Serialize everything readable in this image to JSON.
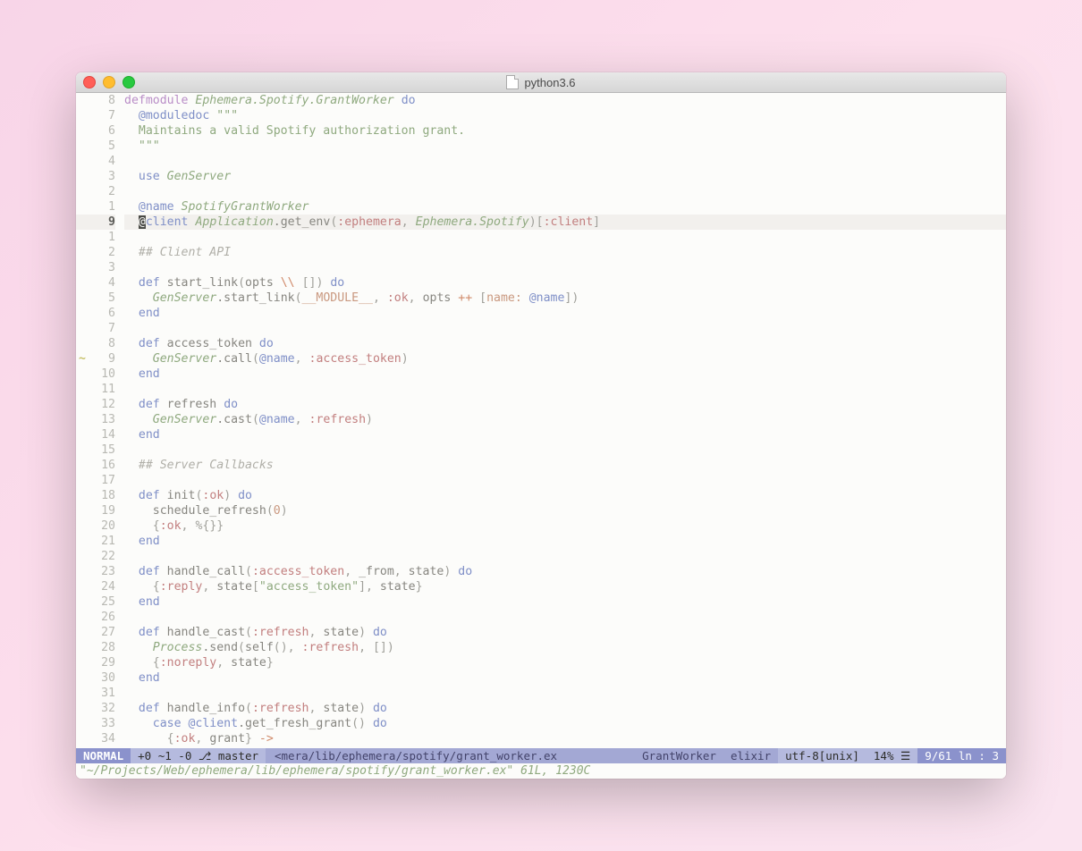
{
  "window": {
    "title": "python3.6"
  },
  "status": {
    "mode": "NORMAL",
    "git_stats": "+0 ~1 -0",
    "git_branch": "master",
    "filepath": "<mera/lib/ephemera/spotify/grant_worker.ex",
    "tag": "GrantWorker",
    "filetype": "elixir",
    "encoding": "utf-8[unix]",
    "percent": "14% ☰",
    "position": "9/61 ln : 3"
  },
  "cmdline": "\"~/Projects/Web/ephemera/lib/ephemera/spotify/grant_worker.ex\" 61L, 1230C",
  "cursor_line_index": 8,
  "lines": [
    {
      "rel": "8",
      "sign": "",
      "tokens": [
        [
          "decl",
          "defmodule"
        ],
        [
          "",
          " "
        ],
        [
          "mod",
          "Ephemera.Spotify.GrantWorker"
        ],
        [
          "",
          " "
        ],
        [
          "kw",
          "do"
        ]
      ]
    },
    {
      "rel": "7",
      "sign": "",
      "tokens": [
        [
          "",
          "  "
        ],
        [
          "attr",
          "@moduledoc"
        ],
        [
          "",
          " "
        ],
        [
          "str",
          "\"\"\""
        ]
      ]
    },
    {
      "rel": "6",
      "sign": "",
      "tokens": [
        [
          "str",
          "  Maintains a valid Spotify authorization grant."
        ]
      ]
    },
    {
      "rel": "5",
      "sign": "",
      "tokens": [
        [
          "str",
          "  \"\"\""
        ]
      ]
    },
    {
      "rel": "4",
      "sign": "",
      "tokens": [
        [
          "",
          ""
        ]
      ]
    },
    {
      "rel": "3",
      "sign": "",
      "tokens": [
        [
          "",
          "  "
        ],
        [
          "kw",
          "use"
        ],
        [
          "",
          " "
        ],
        [
          "mod",
          "GenServer"
        ]
      ]
    },
    {
      "rel": "2",
      "sign": "",
      "tokens": [
        [
          "",
          ""
        ]
      ]
    },
    {
      "rel": "1",
      "sign": "",
      "tokens": [
        [
          "",
          "  "
        ],
        [
          "attr",
          "@name"
        ],
        [
          "",
          " "
        ],
        [
          "mod",
          "SpotifyGrantWorker"
        ]
      ]
    },
    {
      "rel": "9",
      "sign": "",
      "cursor": true,
      "tokens": [
        [
          "",
          "  "
        ],
        [
          "cursor",
          "@"
        ],
        [
          "attr",
          "client"
        ],
        [
          "",
          " "
        ],
        [
          "mod",
          "Application"
        ],
        [
          "fn",
          ".get_env"
        ],
        [
          "paren",
          "("
        ],
        [
          "atom",
          ":ephemera"
        ],
        [
          "paren",
          ","
        ],
        [
          "",
          " "
        ],
        [
          "mod",
          "Ephemera.Spotify"
        ],
        [
          "paren",
          ")["
        ],
        [
          "atom",
          ":client"
        ],
        [
          "paren",
          "]"
        ]
      ]
    },
    {
      "rel": "1",
      "sign": "",
      "tokens": [
        [
          "",
          ""
        ]
      ]
    },
    {
      "rel": "2",
      "sign": "",
      "tokens": [
        [
          "",
          "  "
        ],
        [
          "comm",
          "## Client API"
        ]
      ]
    },
    {
      "rel": "3",
      "sign": "",
      "tokens": [
        [
          "",
          ""
        ]
      ]
    },
    {
      "rel": "4",
      "sign": "",
      "tokens": [
        [
          "",
          "  "
        ],
        [
          "kw",
          "def"
        ],
        [
          "",
          " "
        ],
        [
          "fn",
          "start_link"
        ],
        [
          "paren",
          "("
        ],
        [
          "var",
          "opts "
        ],
        [
          "op",
          "\\\\"
        ],
        [
          "",
          " "
        ],
        [
          "paren",
          "[]) "
        ],
        [
          "kw",
          "do"
        ]
      ]
    },
    {
      "rel": "5",
      "sign": "",
      "tokens": [
        [
          "",
          "    "
        ],
        [
          "mod",
          "GenServer"
        ],
        [
          "fn",
          ".start_link"
        ],
        [
          "paren",
          "("
        ],
        [
          "macro",
          "__MODULE__"
        ],
        [
          "paren",
          ","
        ],
        [
          "",
          " "
        ],
        [
          "atom",
          ":ok"
        ],
        [
          "paren",
          ","
        ],
        [
          "",
          " opts "
        ],
        [
          "op",
          "++"
        ],
        [
          "",
          " "
        ],
        [
          "paren",
          "["
        ],
        [
          "atomk",
          "name:"
        ],
        [
          "",
          " "
        ],
        [
          "attr",
          "@name"
        ],
        [
          "paren",
          "])"
        ]
      ]
    },
    {
      "rel": "6",
      "sign": "",
      "tokens": [
        [
          "",
          "  "
        ],
        [
          "kw",
          "end"
        ]
      ]
    },
    {
      "rel": "7",
      "sign": "",
      "tokens": [
        [
          "",
          ""
        ]
      ]
    },
    {
      "rel": "8",
      "sign": "",
      "tokens": [
        [
          "",
          "  "
        ],
        [
          "kw",
          "def"
        ],
        [
          "",
          " "
        ],
        [
          "fn",
          "access_token"
        ],
        [
          "",
          " "
        ],
        [
          "kw",
          "do"
        ]
      ]
    },
    {
      "rel": "9",
      "sign": "~",
      "sign_color": "#c8c16a",
      "tokens": [
        [
          "",
          "    "
        ],
        [
          "mod",
          "GenServer"
        ],
        [
          "fn",
          ".call"
        ],
        [
          "paren",
          "("
        ],
        [
          "attr",
          "@name"
        ],
        [
          "paren",
          ","
        ],
        [
          "",
          " "
        ],
        [
          "atom",
          ":access_token"
        ],
        [
          "paren",
          ")"
        ]
      ]
    },
    {
      "rel": "10",
      "sign": "",
      "tokens": [
        [
          "",
          "  "
        ],
        [
          "kw",
          "end"
        ]
      ]
    },
    {
      "rel": "11",
      "sign": "",
      "tokens": [
        [
          "",
          ""
        ]
      ]
    },
    {
      "rel": "12",
      "sign": "",
      "tokens": [
        [
          "",
          "  "
        ],
        [
          "kw",
          "def"
        ],
        [
          "",
          " "
        ],
        [
          "fn",
          "refresh"
        ],
        [
          "",
          " "
        ],
        [
          "kw",
          "do"
        ]
      ]
    },
    {
      "rel": "13",
      "sign": "",
      "tokens": [
        [
          "",
          "    "
        ],
        [
          "mod",
          "GenServer"
        ],
        [
          "fn",
          ".cast"
        ],
        [
          "paren",
          "("
        ],
        [
          "attr",
          "@name"
        ],
        [
          "paren",
          ","
        ],
        [
          "",
          " "
        ],
        [
          "atom",
          ":refresh"
        ],
        [
          "paren",
          ")"
        ]
      ]
    },
    {
      "rel": "14",
      "sign": "",
      "tokens": [
        [
          "",
          "  "
        ],
        [
          "kw",
          "end"
        ]
      ]
    },
    {
      "rel": "15",
      "sign": "",
      "tokens": [
        [
          "",
          ""
        ]
      ]
    },
    {
      "rel": "16",
      "sign": "",
      "tokens": [
        [
          "",
          "  "
        ],
        [
          "comm",
          "## Server Callbacks"
        ]
      ]
    },
    {
      "rel": "17",
      "sign": "",
      "tokens": [
        [
          "",
          ""
        ]
      ]
    },
    {
      "rel": "18",
      "sign": "",
      "tokens": [
        [
          "",
          "  "
        ],
        [
          "kw",
          "def"
        ],
        [
          "",
          " "
        ],
        [
          "fn",
          "init"
        ],
        [
          "paren",
          "("
        ],
        [
          "atom",
          ":ok"
        ],
        [
          "paren",
          ") "
        ],
        [
          "kw",
          "do"
        ]
      ]
    },
    {
      "rel": "19",
      "sign": "",
      "tokens": [
        [
          "",
          "    "
        ],
        [
          "fn",
          "schedule_refresh"
        ],
        [
          "paren",
          "("
        ],
        [
          "num",
          "0"
        ],
        [
          "paren",
          ")"
        ]
      ]
    },
    {
      "rel": "20",
      "sign": "",
      "tokens": [
        [
          "",
          "    "
        ],
        [
          "paren",
          "{"
        ],
        [
          "atom",
          ":ok"
        ],
        [
          "paren",
          ","
        ],
        [
          "",
          " "
        ],
        [
          "paren",
          "%{}}"
        ]
      ]
    },
    {
      "rel": "21",
      "sign": "",
      "tokens": [
        [
          "",
          "  "
        ],
        [
          "kw",
          "end"
        ]
      ]
    },
    {
      "rel": "22",
      "sign": "",
      "tokens": [
        [
          "",
          ""
        ]
      ]
    },
    {
      "rel": "23",
      "sign": "",
      "tokens": [
        [
          "",
          "  "
        ],
        [
          "kw",
          "def"
        ],
        [
          "",
          " "
        ],
        [
          "fn",
          "handle_call"
        ],
        [
          "paren",
          "("
        ],
        [
          "atom",
          ":access_token"
        ],
        [
          "paren",
          ","
        ],
        [
          "",
          " _from"
        ],
        [
          "paren",
          ","
        ],
        [
          "",
          " state"
        ],
        [
          "paren",
          ") "
        ],
        [
          "kw",
          "do"
        ]
      ]
    },
    {
      "rel": "24",
      "sign": "",
      "tokens": [
        [
          "",
          "    "
        ],
        [
          "paren",
          "{"
        ],
        [
          "atom",
          ":reply"
        ],
        [
          "paren",
          ","
        ],
        [
          "",
          " state"
        ],
        [
          "paren",
          "["
        ],
        [
          "str",
          "\"access_token\""
        ],
        [
          "paren",
          "],"
        ],
        [
          "",
          " state"
        ],
        [
          "paren",
          "}"
        ]
      ]
    },
    {
      "rel": "25",
      "sign": "",
      "tokens": [
        [
          "",
          "  "
        ],
        [
          "kw",
          "end"
        ]
      ]
    },
    {
      "rel": "26",
      "sign": "",
      "tokens": [
        [
          "",
          ""
        ]
      ]
    },
    {
      "rel": "27",
      "sign": "",
      "tokens": [
        [
          "",
          "  "
        ],
        [
          "kw",
          "def"
        ],
        [
          "",
          " "
        ],
        [
          "fn",
          "handle_cast"
        ],
        [
          "paren",
          "("
        ],
        [
          "atom",
          ":refresh"
        ],
        [
          "paren",
          ","
        ],
        [
          "",
          " state"
        ],
        [
          "paren",
          ") "
        ],
        [
          "kw",
          "do"
        ]
      ]
    },
    {
      "rel": "28",
      "sign": "",
      "tokens": [
        [
          "",
          "    "
        ],
        [
          "mod",
          "Process"
        ],
        [
          "fn",
          ".send"
        ],
        [
          "paren",
          "("
        ],
        [
          "fn",
          "self"
        ],
        [
          "paren",
          "(),"
        ],
        [
          "",
          " "
        ],
        [
          "atom",
          ":refresh"
        ],
        [
          "paren",
          ","
        ],
        [
          "",
          " "
        ],
        [
          "paren",
          "[])"
        ]
      ]
    },
    {
      "rel": "29",
      "sign": "",
      "tokens": [
        [
          "",
          "    "
        ],
        [
          "paren",
          "{"
        ],
        [
          "atom",
          ":noreply"
        ],
        [
          "paren",
          ","
        ],
        [
          "",
          " state"
        ],
        [
          "paren",
          "}"
        ]
      ]
    },
    {
      "rel": "30",
      "sign": "",
      "tokens": [
        [
          "",
          "  "
        ],
        [
          "kw",
          "end"
        ]
      ]
    },
    {
      "rel": "31",
      "sign": "",
      "tokens": [
        [
          "",
          ""
        ]
      ]
    },
    {
      "rel": "32",
      "sign": "",
      "tokens": [
        [
          "",
          "  "
        ],
        [
          "kw",
          "def"
        ],
        [
          "",
          " "
        ],
        [
          "fn",
          "handle_info"
        ],
        [
          "paren",
          "("
        ],
        [
          "atom",
          ":refresh"
        ],
        [
          "paren",
          ","
        ],
        [
          "",
          " state"
        ],
        [
          "paren",
          ") "
        ],
        [
          "kw",
          "do"
        ]
      ]
    },
    {
      "rel": "33",
      "sign": "",
      "tokens": [
        [
          "",
          "    "
        ],
        [
          "kw",
          "case"
        ],
        [
          "",
          " "
        ],
        [
          "attr",
          "@client"
        ],
        [
          "fn",
          ".get_fresh_grant"
        ],
        [
          "paren",
          "() "
        ],
        [
          "kw",
          "do"
        ]
      ]
    },
    {
      "rel": "34",
      "sign": "",
      "tokens": [
        [
          "",
          "      "
        ],
        [
          "paren",
          "{"
        ],
        [
          "atom",
          ":ok"
        ],
        [
          "paren",
          ","
        ],
        [
          "",
          " grant"
        ],
        [
          "paren",
          "}"
        ],
        [
          "",
          " "
        ],
        [
          "op",
          "->"
        ]
      ]
    }
  ]
}
